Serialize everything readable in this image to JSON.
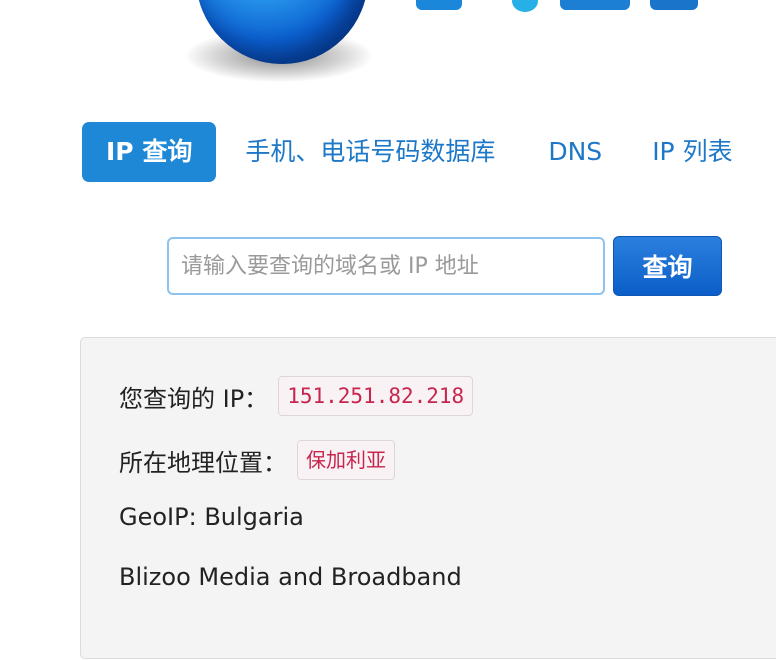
{
  "logo": {
    "icon": "globe-logo-icon"
  },
  "nav": {
    "tabs": [
      {
        "label": "IP 查询",
        "active": true
      },
      {
        "label": "手机、电话号码数据库",
        "active": false
      },
      {
        "label": "DNS",
        "active": false
      },
      {
        "label": "IP 列表",
        "active": false
      }
    ]
  },
  "search": {
    "placeholder": "请输入要查询的域名或 IP 地址",
    "value": "",
    "button_label": "查询"
  },
  "result": {
    "ip_label": "您查询的 IP：",
    "ip_value": "151.251.82.218",
    "location_label": "所在地理位置：",
    "location_value": "保加利亚",
    "geoip": "GeoIP: Bulgaria",
    "isp": "Blizoo Media and Broadband"
  },
  "colors": {
    "accent": "#1e88d6",
    "link": "#1e78c8",
    "highlight": "#c7254e",
    "panel_bg": "#f4f4f4"
  }
}
